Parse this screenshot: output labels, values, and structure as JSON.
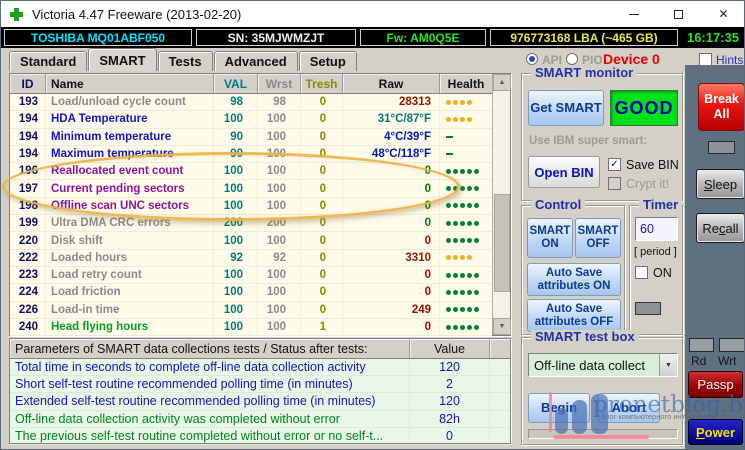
{
  "window": {
    "title": "Victoria 4.47  Freeware (2013-02-20)",
    "controls": {
      "close": "✕"
    }
  },
  "infobar": {
    "model": "TOSHIBA MQ01ABF050",
    "serial": "SN: 35MJWMZJT",
    "firmware": "Fw: AM0Q5E",
    "capacity": "976773168 LBA (~465 GB)",
    "time": "16:17:35"
  },
  "tabs": {
    "items": [
      {
        "label": "Standard",
        "active": false
      },
      {
        "label": "SMART",
        "active": true
      },
      {
        "label": "Tests",
        "active": false
      },
      {
        "label": "Advanced",
        "active": false
      },
      {
        "label": "Setup",
        "active": false
      }
    ]
  },
  "modebar": {
    "api_label": "API",
    "pio_label": "PIO",
    "device_label": "Device 0",
    "hints_label": "Hints"
  },
  "smart_table": {
    "headers": {
      "id": "ID",
      "name": "Name",
      "val": "VAL",
      "wrst": "Wrst",
      "tresh": "Tresh",
      "raw": "Raw",
      "health": "Health"
    },
    "rows": [
      {
        "id": "193",
        "name": "Load/unload cycle count",
        "name_style": "gray",
        "val": "98",
        "wrst": "98",
        "tresh": "0",
        "raw": "28313",
        "raw_style": "darkred",
        "health": {
          "dots": 4,
          "style": "gold"
        }
      },
      {
        "id": "194",
        "name": "HDA Temperature",
        "name_style": "blue",
        "val": "100",
        "wrst": "100",
        "tresh": "0",
        "raw": "31°C/87°F",
        "raw_style": "teal",
        "health": {
          "dots": 4,
          "style": "gold"
        }
      },
      {
        "id": "194",
        "name": "Minimum temperature",
        "name_style": "blue",
        "val": "90",
        "wrst": "100",
        "tresh": "0",
        "raw": "4°C/39°F",
        "raw_style": "blue",
        "health": {
          "dash": true
        }
      },
      {
        "id": "194",
        "name": "Maximum temperature",
        "name_style": "blue",
        "val": "90",
        "wrst": "100",
        "tresh": "0",
        "raw": "48°C/118°F",
        "raw_style": "blue",
        "health": {
          "dash": true
        }
      },
      {
        "id": "196",
        "name": "Reallocated event count",
        "name_style": "purple",
        "val": "100",
        "wrst": "100",
        "tresh": "0",
        "raw": "0",
        "raw_style": "green",
        "health": {
          "dots": 5,
          "style": "green"
        }
      },
      {
        "id": "197",
        "name": "Current pending sectors",
        "name_style": "purple",
        "val": "100",
        "wrst": "100",
        "tresh": "0",
        "raw": "0",
        "raw_style": "green",
        "health": {
          "dots": 5,
          "style": "green"
        }
      },
      {
        "id": "198",
        "name": "Offline scan UNC sectors",
        "name_style": "purple",
        "val": "100",
        "wrst": "100",
        "tresh": "0",
        "raw": "0",
        "raw_style": "green",
        "health": {
          "dots": 5,
          "style": "green"
        }
      },
      {
        "id": "199",
        "name": "Ultra DMA CRC errors",
        "name_style": "gray",
        "val": "200",
        "wrst": "200",
        "tresh": "0",
        "raw": "0",
        "raw_style": "green",
        "health": {
          "dots": 5,
          "style": "green"
        }
      },
      {
        "id": "220",
        "name": "Disk shift",
        "name_style": "gray",
        "val": "100",
        "wrst": "100",
        "tresh": "0",
        "raw": "0",
        "raw_style": "red",
        "health": {
          "dots": 5,
          "style": "green"
        }
      },
      {
        "id": "222",
        "name": "Loaded hours",
        "name_style": "gray",
        "val": "92",
        "wrst": "92",
        "tresh": "0",
        "raw": "3310",
        "raw_style": "darkred",
        "health": {
          "dots": 4,
          "style": "gold"
        }
      },
      {
        "id": "223",
        "name": "Load retry count",
        "name_style": "gray",
        "val": "100",
        "wrst": "100",
        "tresh": "0",
        "raw": "0",
        "raw_style": "red",
        "health": {
          "dots": 5,
          "style": "green"
        }
      },
      {
        "id": "224",
        "name": "Load friction",
        "name_style": "gray",
        "val": "100",
        "wrst": "100",
        "tresh": "0",
        "raw": "0",
        "raw_style": "red",
        "health": {
          "dots": 5,
          "style": "green"
        }
      },
      {
        "id": "226",
        "name": "Load-in time",
        "name_style": "gray",
        "val": "100",
        "wrst": "100",
        "tresh": "0",
        "raw": "249",
        "raw_style": "darkred",
        "health": {
          "dots": 5,
          "style": "green"
        }
      },
      {
        "id": "240",
        "name": "Head flying hours",
        "name_style": "green",
        "val": "100",
        "wrst": "100",
        "tresh": "1",
        "raw": "0",
        "raw_style": "red",
        "health": {
          "dots": 5,
          "style": "green"
        }
      }
    ]
  },
  "params_table": {
    "header": "Parameters of SMART data collections tests / Status after tests:",
    "value_header": "Value",
    "rows": [
      {
        "label": "Total time in seconds to complete off-line data collection activity",
        "value": "120",
        "style": "blue"
      },
      {
        "label": "Short self-test routine recommended polling time (in minutes)",
        "value": "2",
        "style": "blue"
      },
      {
        "label": "Extended self-test routine recommended polling time (in minutes)",
        "value": "120",
        "style": "blue"
      },
      {
        "label": "Off-line data collection activity was completed without error",
        "value": "82h",
        "style": "green"
      },
      {
        "label": "The previous self-test routine completed without error or no self-t...",
        "value": "0",
        "style": "green"
      }
    ]
  },
  "smart_monitor": {
    "title": "SMART monitor",
    "get_smart": "Get SMART",
    "status": "GOOD",
    "ibm_label": "Use IBM super smart:",
    "open_bin": "Open BIN",
    "save_bin": "Save BIN",
    "crypt": "Crypt it!",
    "check_glyph": "✓"
  },
  "control": {
    "title": "Control",
    "smart_on": "SMART ON",
    "smart_off": "SMART OFF",
    "autosave_on": "Auto Save attributes ON",
    "autosave_off": "Auto Save attributes OFF"
  },
  "timer": {
    "title": "Timer",
    "value": "60",
    "period": "[ period ]",
    "on_label": "ON"
  },
  "test_box": {
    "title": "SMART test box",
    "selected": "Off-line data collect",
    "begin": "Begin",
    "abort": "Abort"
  },
  "side": {
    "break_all": "Break All",
    "sleep": {
      "pre": "",
      "u": "S",
      "post": "leep"
    },
    "recall": {
      "pre": "Re",
      "u": "c",
      "post": "all"
    },
    "rd": "Rd",
    "wrt": "Wrt",
    "passp": "Passp",
    "power": {
      "pre": "",
      "u": "P",
      "post": "ower"
    }
  },
  "watermark": {
    "text": "pronetblog.by",
    "tagline": "блог компьютерного интересного"
  },
  "colors": {
    "status_good_bg": "#00e018",
    "break_all_red": "#e81414",
    "health_gold": "#efb11d",
    "health_green": "#067f39"
  }
}
